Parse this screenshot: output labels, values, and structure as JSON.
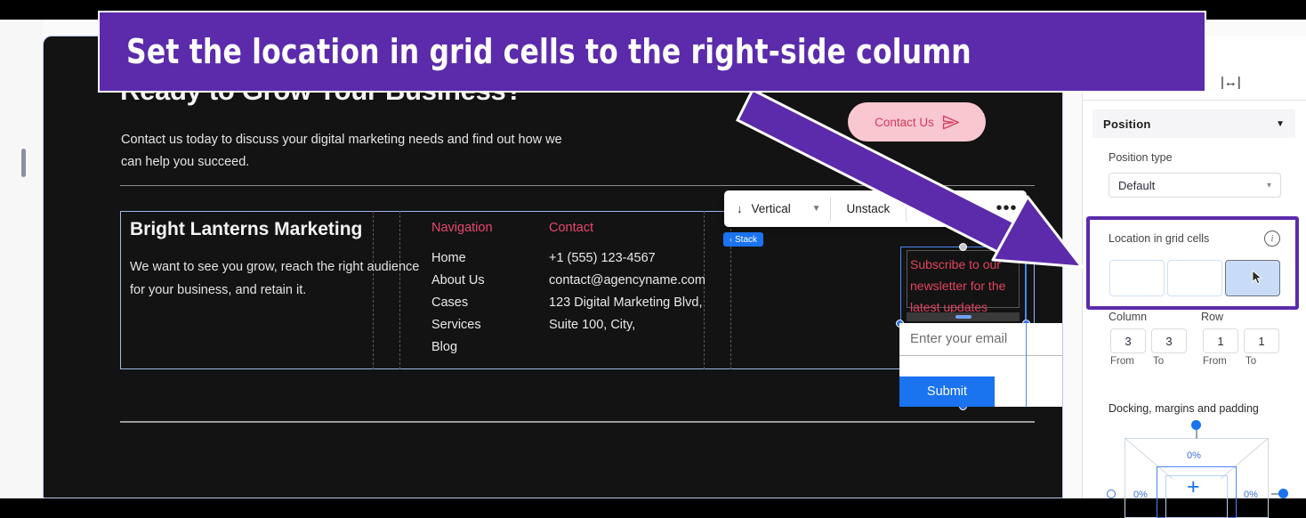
{
  "callout": {
    "text": "Set the location in grid cells to the right-side column"
  },
  "canvas": {
    "hero": {
      "title": "Ready to Grow Your Business?",
      "subtitle": "Contact us today to discuss your digital marketing needs and find out how we can help you succeed.",
      "cta_label": "Contact Us",
      "cta_icon": "paper-plane-icon"
    },
    "footer": {
      "brand": "Bright Lanterns Marketing",
      "brand_tagline": "We want to see you grow, reach the right audience for your business, and retain it.",
      "columns": [
        {
          "heading": "Navigation",
          "items": [
            "Home",
            "About Us",
            "Cases",
            "Services",
            "Blog"
          ]
        },
        {
          "heading": "Contact",
          "items": [
            "+1 (555) 123-4567",
            "contact@agencyname.com",
            "123 Digital Marketing Blvd,",
            "Suite 100, City,"
          ]
        }
      ],
      "subscribe": {
        "text": "Subscribe to our newsletter for the latest updates",
        "email_placeholder": "Enter your email",
        "submit_label": "Submit"
      }
    },
    "stack_toolbar": {
      "direction_icon": "arrow-down-icon",
      "direction_label": "Vertical",
      "caret_icon": "chevron-down-icon",
      "unstack_label": "Unstack",
      "help_label": "?",
      "more_label": "•••"
    },
    "stack_badge": {
      "chevron": "‹",
      "label": "Stack"
    }
  },
  "right_panel": {
    "fit_width_icon": "fit-width-icon",
    "section": {
      "title": "Position",
      "collapse_icon": "caret-down-icon"
    },
    "position_type": {
      "label": "Position type",
      "value": "Default",
      "caret_icon": "chevron-down-icon"
    },
    "grid_location": {
      "label": "Location in grid cells",
      "info_icon": "info-icon",
      "cells": [
        {
          "name": "cell-1",
          "selected": false
        },
        {
          "name": "cell-2",
          "selected": false
        },
        {
          "name": "cell-3",
          "selected": true
        }
      ],
      "cursor_icon": "mouse-pointer-icon"
    },
    "column": {
      "label": "Column",
      "from_value": "3",
      "to_value": "3",
      "from_label": "From",
      "to_label": "To"
    },
    "row": {
      "label": "Row",
      "from_value": "1",
      "to_value": "1",
      "from_label": "From",
      "to_label": "To"
    },
    "docking": {
      "label": "Docking, margins and padding",
      "top_value": "0%",
      "left_value": "0%",
      "right_value": "0%",
      "center_icon": "plus-icon"
    }
  },
  "colors": {
    "accent_purple": "#5b2bab",
    "canvas_bg": "#131313",
    "blue": "#1a73ef",
    "pink": "#f9c7d0",
    "heading_red": "#e8486b"
  }
}
